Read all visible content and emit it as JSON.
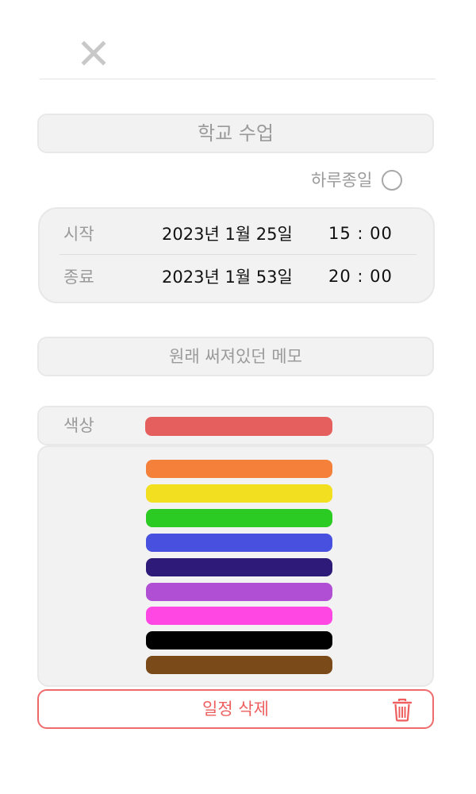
{
  "header": {
    "close_icon": "close-icon"
  },
  "event": {
    "title": "학교 수업"
  },
  "allday": {
    "label": "하루종일",
    "checked": false
  },
  "time": {
    "start": {
      "label": "시작",
      "date": "2023년 1월 25일",
      "clock": "15 : 00"
    },
    "end": {
      "label": "종료",
      "date": "2023년 1월 53일",
      "clock": "20 : 00"
    }
  },
  "memo": {
    "text": "원래 써져있던 메모"
  },
  "color": {
    "label": "색상",
    "selected": "#e65f5f",
    "options": [
      "#f5803a",
      "#f2df1f",
      "#2bcb23",
      "#4850e0",
      "#2e1b79",
      "#b04ed4",
      "#ff47e3",
      "#000000",
      "#7b4a19"
    ]
  },
  "delete": {
    "label": "일정 삭제",
    "icon": "trash-icon",
    "accent": "#ee5e5e"
  }
}
